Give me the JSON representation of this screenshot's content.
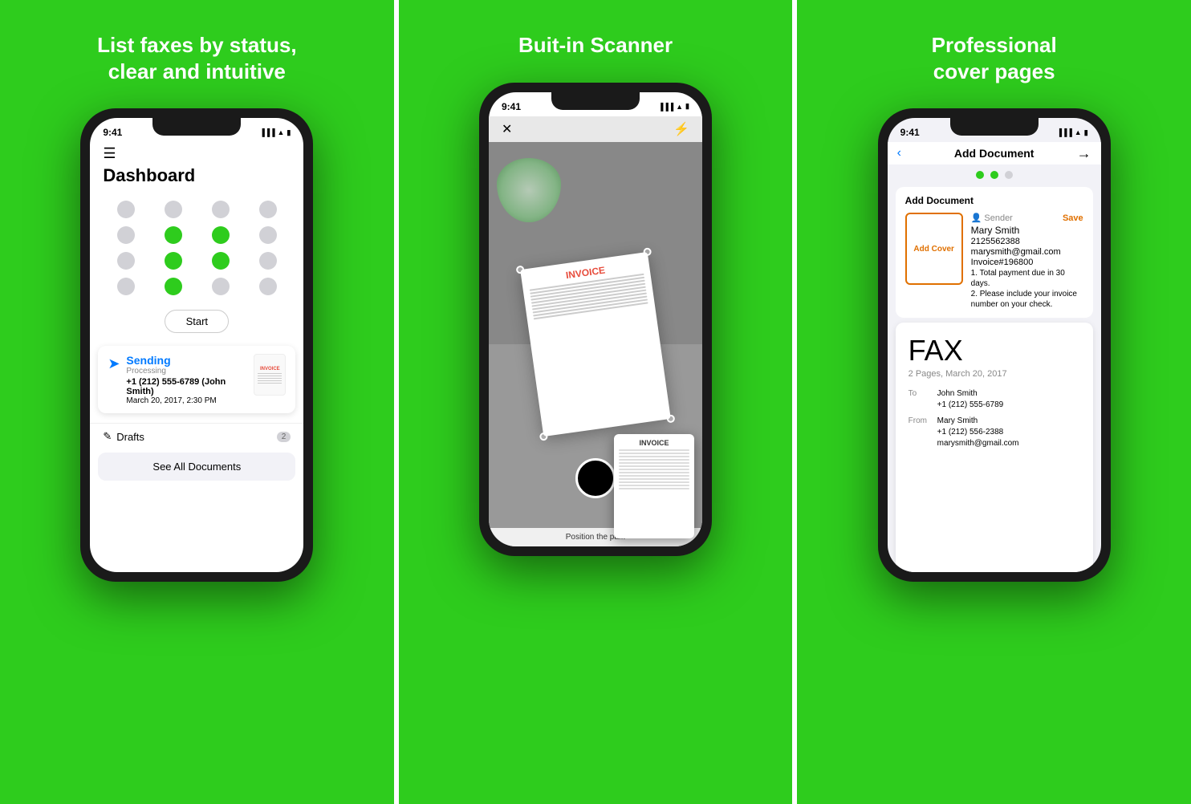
{
  "panels": [
    {
      "id": "panel1",
      "title": "List faxes by status,\nclear and intuitive",
      "screen": {
        "status_time": "9:41",
        "dashboard_title": "Dashboard",
        "dot_grid": [
          "gray",
          "gray",
          "gray",
          "gray",
          "gray",
          "green",
          "green",
          "gray",
          "gray",
          "green",
          "green",
          "gray",
          "gray",
          "green",
          "gray",
          "gray"
        ],
        "start_button": "Start",
        "sending_card": {
          "status": "Sending",
          "processing": "Processing",
          "number": "+1 (212) 555-6789 (John Smith)",
          "date": "March 20, 2017, 2:30 PM"
        },
        "drafts_label": "Drafts",
        "drafts_count": "2",
        "see_all": "See All Documents"
      }
    },
    {
      "id": "panel2",
      "title": "Buit-in Scanner",
      "screen": {
        "status_time": "9:41",
        "hint_text": "Position the pa...",
        "invoice_label": "INVOICE",
        "preview_invoice_label": "INVOICE"
      }
    },
    {
      "id": "panel3",
      "title": "Professional\ncover pages",
      "screen": {
        "status_time": "9:41",
        "nav_title": "Add Document",
        "add_doc_label": "Add Document",
        "add_cover_text": "Add Cover",
        "sender_label": "Sender",
        "save_label": "Save",
        "sender_name": "Mary Smith",
        "sender_phone": "2125562388",
        "sender_email": "marysmith@gmail.com",
        "sender_invoice": "Invoice#196800",
        "sender_note1": "1. Total payment due in 30 days.",
        "sender_note2": "2. Please include your invoice number on your check.",
        "fax_title": "FAX",
        "fax_subtitle": "2 Pages, March 20, 2017",
        "fax_to_name": "John Smith",
        "fax_to_phone": "+1 (212) 555-6789",
        "fax_from_name": "Mary Smith",
        "fax_from_phone": "+1 (212) 556-2388",
        "fax_from_email": "marysmith@gmail.com"
      }
    }
  ]
}
